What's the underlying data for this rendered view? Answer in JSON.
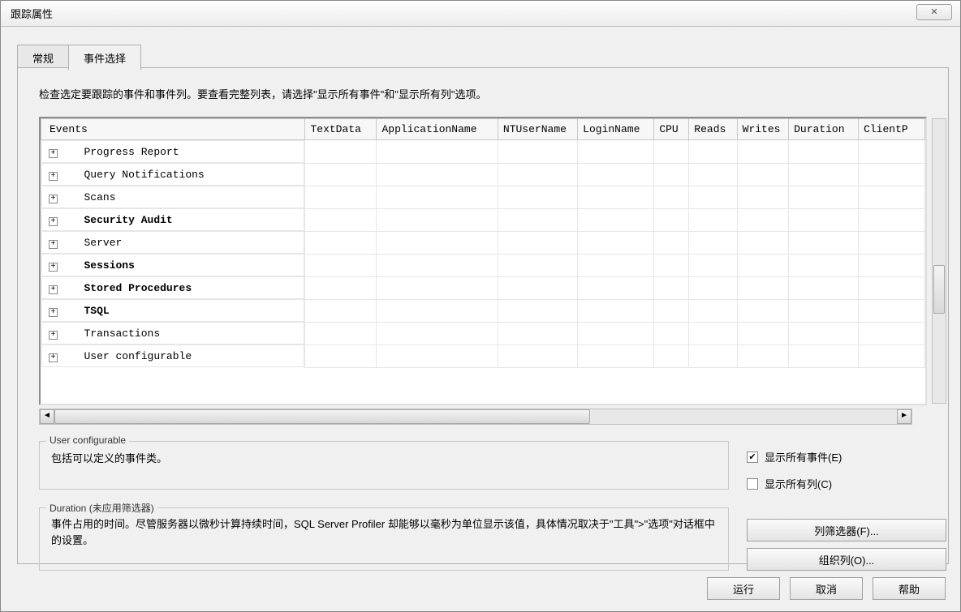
{
  "window": {
    "title": "跟踪属性",
    "close_glyph": "✕"
  },
  "tabs": {
    "general": "常规",
    "events": "事件选择"
  },
  "instruction": "检查选定要跟踪的事件和事件列。要查看完整列表，请选择\"显示所有事件\"和\"显示所有列\"选项。",
  "grid": {
    "columns": [
      "Events",
      "TextData",
      "ApplicationName",
      "NTUserName",
      "LoginName",
      "CPU",
      "Reads",
      "Writes",
      "Duration",
      "ClientP"
    ],
    "rows": [
      {
        "name": "Progress Report",
        "bold": false
      },
      {
        "name": "Query Notifications",
        "bold": false
      },
      {
        "name": "Scans",
        "bold": false
      },
      {
        "name": "Security Audit",
        "bold": true
      },
      {
        "name": "Server",
        "bold": false
      },
      {
        "name": "Sessions",
        "bold": true
      },
      {
        "name": "Stored Procedures",
        "bold": true
      },
      {
        "name": "TSQL",
        "bold": true
      },
      {
        "name": "Transactions",
        "bold": false
      },
      {
        "name": "User configurable",
        "bold": false
      }
    ],
    "expand_glyph": "+"
  },
  "groupbox1": {
    "legend": "User configurable",
    "text": "包括可以定义的事件类。"
  },
  "groupbox2": {
    "legend": "Duration (未应用筛选器)",
    "text": "事件占用的时间。尽管服务器以微秒计算持续时间，SQL Server Profiler 却能够以毫秒为单位显示该值，具体情况取决于\"工具\">\"选项\"对话框中的设置。"
  },
  "checkboxes": {
    "show_all_events": "显示所有事件(E)",
    "show_all_cols": "显示所有列(C)",
    "checked_glyph": "✔"
  },
  "buttons": {
    "col_filter": "列筛选器(F)...",
    "organize_cols": "组织列(O)...",
    "run": "运行",
    "cancel": "取消",
    "help": "帮助"
  },
  "scroll": {
    "left_glyph": "◄",
    "right_glyph": "►"
  }
}
